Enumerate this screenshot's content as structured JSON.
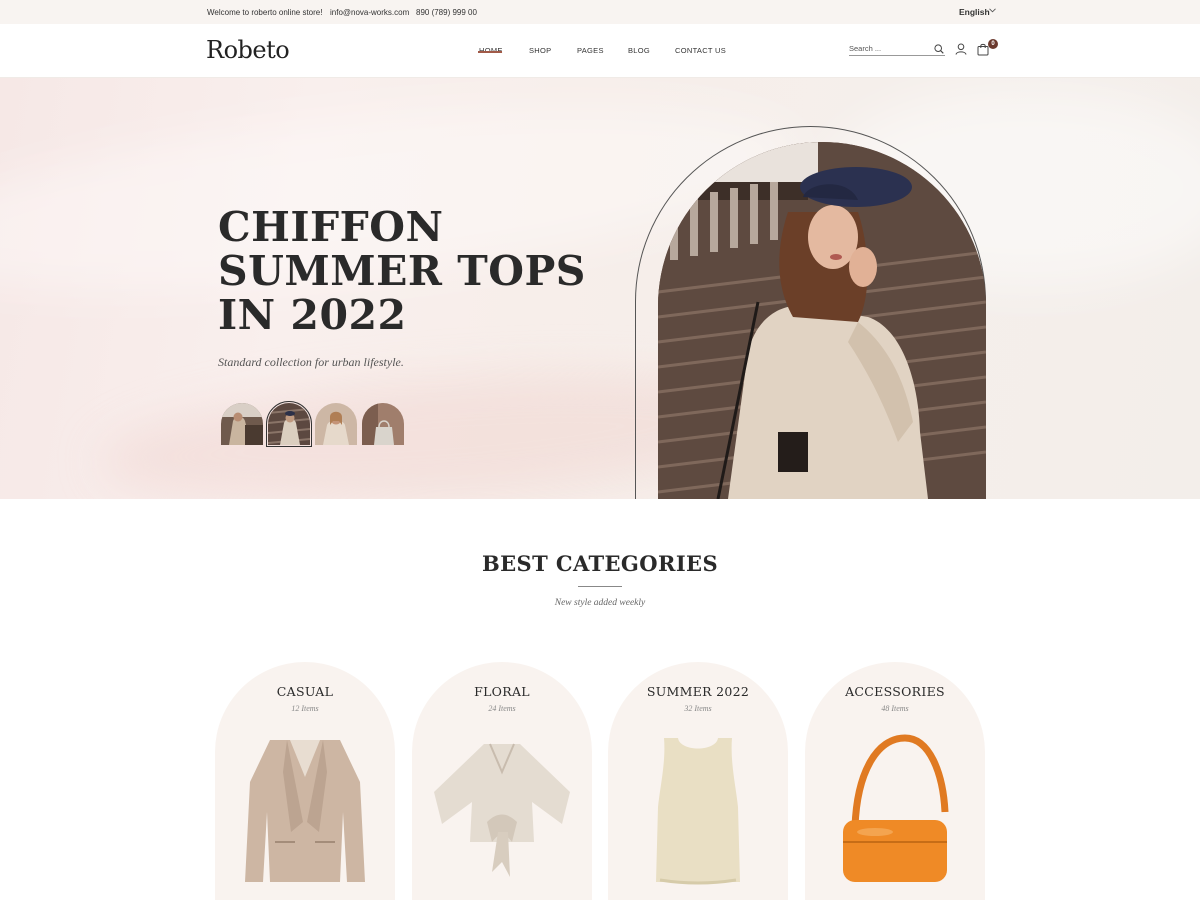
{
  "topbar": {
    "welcome": "Welcome to roberto online store!",
    "email": "info@nova-works.com",
    "phone": "890 (789) 999 00",
    "language": "English"
  },
  "header": {
    "logo": "Robeto",
    "nav": [
      "HOME",
      "SHOP",
      "PAGES",
      "BLOG",
      "CONTACT US"
    ],
    "active_nav": "HOME",
    "search_placeholder": "Search ...",
    "cart_count": "0"
  },
  "hero": {
    "title_lines": [
      "CHIFFON",
      "SUMMER TOPS",
      "IN 2022"
    ],
    "subtitle": "Standard collection for urban lifestyle.",
    "thumbnail_count": 4,
    "active_thumbnail": 2
  },
  "categories": {
    "title": "BEST CATEGORIES",
    "subtitle": "New style added weekly",
    "items": [
      {
        "name": "CASUAL",
        "count": "12 Items",
        "icon": "blazer-icon"
      },
      {
        "name": "FLORAL",
        "count": "24 Items",
        "icon": "blouse-icon"
      },
      {
        "name": "SUMMER 2022",
        "count": "32 Items",
        "icon": "tank-top-icon"
      },
      {
        "name": "ACCESSORIES",
        "count": "48 Items",
        "icon": "handbag-icon"
      }
    ]
  },
  "colors": {
    "accent": "#a15a48",
    "badge": "#6b3a2e",
    "card_bg": "#f9f3ef",
    "hero_bg": "#f7ebe8"
  }
}
